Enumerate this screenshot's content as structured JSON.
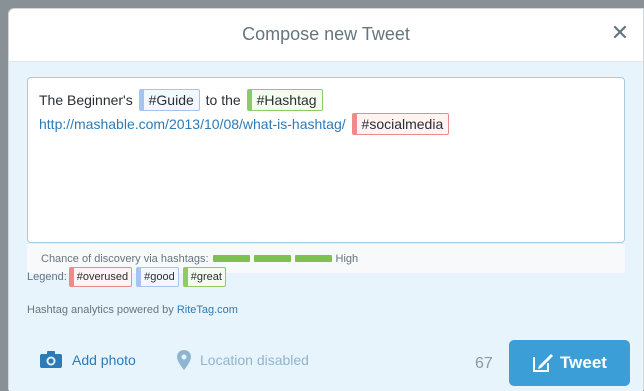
{
  "dialog": {
    "title": "Compose new Tweet",
    "close_icon": "close-icon"
  },
  "composer": {
    "segments": [
      {
        "text": "The Beginner's ",
        "kind": "text"
      },
      {
        "text": "#Guide",
        "kind": "good"
      },
      {
        "text": " to the ",
        "kind": "text"
      },
      {
        "text": "#Hashtag",
        "kind": "great"
      }
    ],
    "line2_link": "http://mashable.com/2013/10/08/what-is-hashtag/",
    "line2_tag": "#socialmedia",
    "line2_tag_kind": "overused"
  },
  "discovery": {
    "label": "Chance of discovery via hashtags:",
    "level": "High",
    "bars_filled": 3,
    "bars_total": 3
  },
  "legend": {
    "label": "Legend:",
    "overused": "#overused",
    "good": "#good",
    "great": "#great"
  },
  "powered": {
    "prefix": "Hashtag analytics powered by ",
    "brand": "RiteTag.com"
  },
  "footer": {
    "add_photo": "Add photo",
    "location": "Location disabled",
    "char_count": "67",
    "tweet_button": "Tweet"
  },
  "colors": {
    "good": "#a6c4f2",
    "great": "#8fca66",
    "overused": "#f08a8a",
    "accent": "#3c9ed6"
  }
}
